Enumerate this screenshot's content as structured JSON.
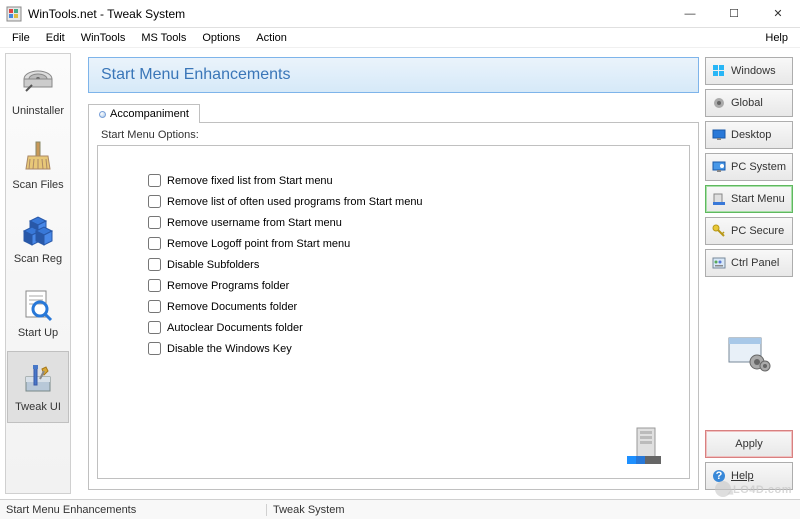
{
  "window": {
    "title": "WinTools.net - Tweak System"
  },
  "win_controls": {
    "min": "—",
    "max": "☐",
    "close": "✕"
  },
  "menu": {
    "file": "File",
    "edit": "Edit",
    "wintools": "WinTools",
    "mstools": "MS Tools",
    "options": "Options",
    "action": "Action",
    "help": "Help"
  },
  "left_tools": [
    {
      "label": "Uninstaller"
    },
    {
      "label": "Scan Files"
    },
    {
      "label": "Scan Reg"
    },
    {
      "label": "Start Up"
    },
    {
      "label": "Tweak UI"
    }
  ],
  "page": {
    "title": "Start Menu Enhancements",
    "tab": "Accompaniment",
    "group_label": "Start Menu Options:",
    "options": [
      "Remove fixed list from Start menu",
      "Remove list of often used programs from Start menu",
      "Remove username from Start menu",
      "Remove Logoff point from Start menu",
      "Disable Subfolders",
      "Remove Programs folder",
      "Remove Documents folder",
      "Autoclear Documents folder",
      "Disable the Windows Key"
    ]
  },
  "right_buttons": [
    {
      "label": "Windows",
      "icon": "windows"
    },
    {
      "label": "Global",
      "icon": "gear"
    },
    {
      "label": "Desktop",
      "icon": "monitor-blue"
    },
    {
      "label": "PC System",
      "icon": "monitor-sys"
    },
    {
      "label": "Start Menu",
      "icon": "startmenu",
      "selected": true
    },
    {
      "label": "PC Secure",
      "icon": "key"
    },
    {
      "label": "Ctrl Panel",
      "icon": "panel"
    }
  ],
  "actions": {
    "apply": "Apply",
    "help": "Help"
  },
  "status": {
    "left": "Start Menu Enhancements",
    "right": "Tweak System"
  },
  "watermark": "LO4D.com"
}
